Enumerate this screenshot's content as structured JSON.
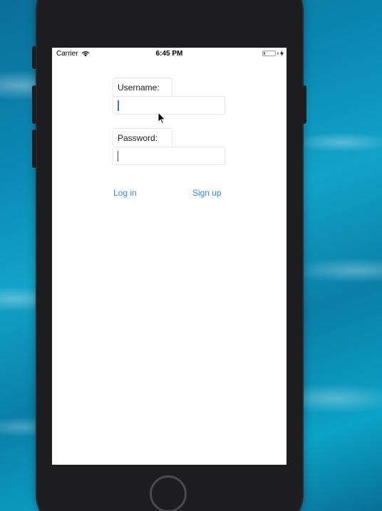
{
  "status_bar": {
    "carrier": "Carrier",
    "time": "6:45 PM",
    "battery_level": 0.15,
    "battery_color": "#ff3b30"
  },
  "form": {
    "username_label": "Username:",
    "username_value": "",
    "password_label": "Password:",
    "password_value": ""
  },
  "actions": {
    "login_label": "Log in",
    "signup_label": "Sign up",
    "accent_color": "#2f86ee"
  },
  "icons": {
    "wifi": "wifi-icon",
    "battery": "battery-icon",
    "charging": "charging-bolt-icon",
    "cursor": "mouse-pointer-icon"
  }
}
